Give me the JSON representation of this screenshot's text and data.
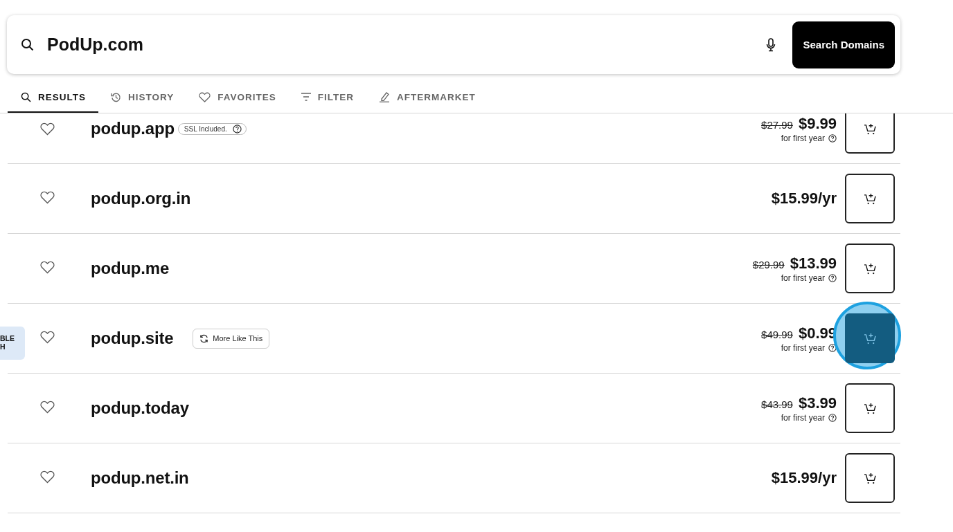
{
  "search": {
    "value": "PodUp.com",
    "button": "Search Domains"
  },
  "tabs": [
    {
      "label": "RESULTS",
      "selected": true
    },
    {
      "label": "HISTORY",
      "selected": false
    },
    {
      "label": "FAVORITES",
      "selected": false
    },
    {
      "label": "FILTER",
      "selected": false
    },
    {
      "label": "AFTERMARKET",
      "selected": false
    }
  ],
  "side_tab": {
    "lines": [
      "BLE",
      "H"
    ]
  },
  "results": [
    {
      "domain": "podup.app",
      "tag": {
        "kind": "ssl",
        "label": "SSL Included."
      },
      "old_price": "$27.99",
      "price": "$9.99",
      "note": "for first year",
      "favorite": false,
      "highlighted": false
    },
    {
      "domain": "podup.org.in",
      "price": "$15.99/yr",
      "favorite": false,
      "highlighted": false
    },
    {
      "domain": "podup.me",
      "old_price": "$29.99",
      "price": "$13.99",
      "note": "for first year",
      "favorite": false,
      "highlighted": false
    },
    {
      "domain": "podup.site",
      "tag": {
        "kind": "more",
        "label": "More Like This"
      },
      "old_price": "$49.99",
      "price": "$0.99",
      "note": "for first year",
      "favorite": false,
      "highlighted": true
    },
    {
      "domain": "podup.today",
      "old_price": "$43.99",
      "price": "$3.99",
      "note": "for first year",
      "favorite": false,
      "highlighted": false
    },
    {
      "domain": "podup.net.in",
      "price": "$15.99/yr",
      "favorite": false,
      "highlighted": false
    }
  ]
}
